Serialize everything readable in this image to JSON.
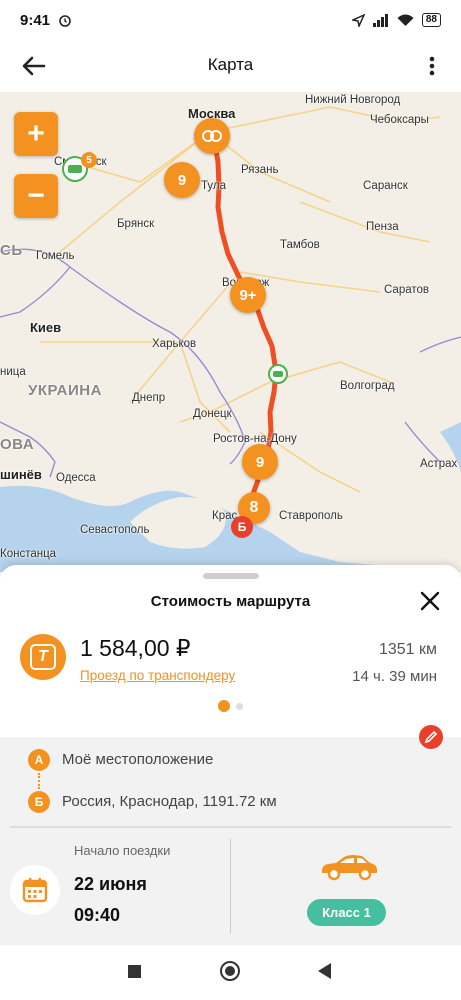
{
  "status_bar": {
    "time": "9:41",
    "battery": "88"
  },
  "header": {
    "title": "Карта"
  },
  "map": {
    "labels": {
      "moscow": "Москва",
      "nizhny": "Нижний Новгород",
      "cheboksary": "Чебоксары",
      "smolensk": "Смоленск",
      "ryazan": "Рязань",
      "tula": "Тула",
      "saransk": "Саранск",
      "bryansk": "Брянск",
      "penza": "Пенза",
      "tambov": "Тамбов",
      "gomel": "Гомель",
      "voronezh": "Воронеж",
      "saratov": "Саратов",
      "kiev": "Киев",
      "kharkov": "Харьков",
      "ukraine": "УКРАИНА",
      "volgograd": "Волгоград",
      "dnepr": "Днепр",
      "donetsk": "Донецк",
      "rostov": "Ростов-на-Дону",
      "odessa": "Одесса",
      "astrakhan": "Астрах",
      "kishinev": "шинёв",
      "krasnodar": "Крас",
      "stavropol": "Ставрополь",
      "sevastopol": "Севастополь",
      "constanta": "Констанца",
      "belarus_part": "СЬ",
      "nitsa": "ница",
      "ova": "ОВА"
    },
    "pins": [
      "9",
      "9+",
      "9",
      "8"
    ],
    "poi_badge": "5",
    "marker_b": "Б"
  },
  "sheet": {
    "title": "Стоимость маршрута",
    "price": "1 584,00 ₽",
    "pay_method": "Проезд по транспондеру",
    "distance": "1351 км",
    "duration": "14 ч. 39 мин",
    "point_a_letter": "А",
    "point_a": "Моё местоположение",
    "point_b_letter": "Б",
    "point_b": "Россия, Краснодар, 1191.72 км",
    "start_label": "Начало поездки",
    "start_date": "22 июня",
    "start_time": "09:40",
    "vehicle_class": "Класс 1"
  },
  "colors": {
    "accent": "#f39221",
    "route": "#f04e23",
    "class_button": "#45bfa0",
    "edit": "#e8402b"
  }
}
